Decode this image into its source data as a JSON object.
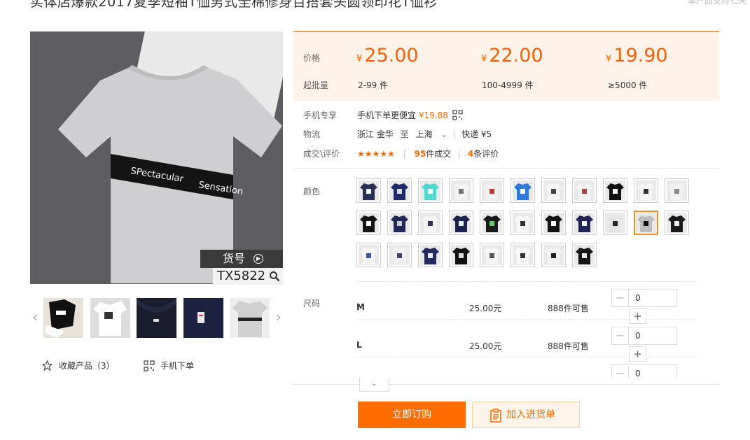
{
  "title": "实体店爆款2017夏季短袖T恤男式全棉修身百搭套头圆领印花T恤衫",
  "top_note": "本产品支持七天",
  "gallery": {
    "sku_label": "货号",
    "sku_code": "TX5822",
    "shirt_text_left": "SPectacular",
    "shirt_text_right": "Sensation"
  },
  "actions": {
    "favorite_label": "收藏产品（3）",
    "mobile_label": "手机下单"
  },
  "prices": {
    "price_label": "价格",
    "moq_label": "起批量",
    "currency": "¥",
    "tiers": [
      {
        "price": "25.00",
        "qty": "2-99 件"
      },
      {
        "price": "22.00",
        "qty": "100-4999 件"
      },
      {
        "price": "19.90",
        "qty": "≥5000 件"
      }
    ]
  },
  "info": {
    "mobile_label": "手机专享",
    "mobile_text": "手机下单更便宜",
    "mobile_price": "¥19.88",
    "logistics_label": "物流",
    "origin": "浙江 金华",
    "to": "至",
    "destination": "上海",
    "express": "快递 ¥5",
    "deals_label": "成交\\评价",
    "stars": "★★★★★",
    "sold_count": "95",
    "sold_text": "件成交",
    "review_count": "4",
    "review_text": "条评价"
  },
  "color_label": "颜色",
  "size_label": "尺码",
  "sizes": [
    {
      "name": "M",
      "price": "25.00元",
      "stock": "888件可售",
      "qty": "0"
    },
    {
      "name": "L",
      "price": "25.00元",
      "stock": "888件可售",
      "qty": "0"
    },
    {
      "name": "",
      "price": "",
      "stock": "",
      "qty": "0"
    }
  ],
  "buttons": {
    "buy": "立即订购",
    "cart": "加入进货单"
  },
  "colors": {
    "accent": "#ff6d00",
    "price_bg": "#fff3e9"
  }
}
